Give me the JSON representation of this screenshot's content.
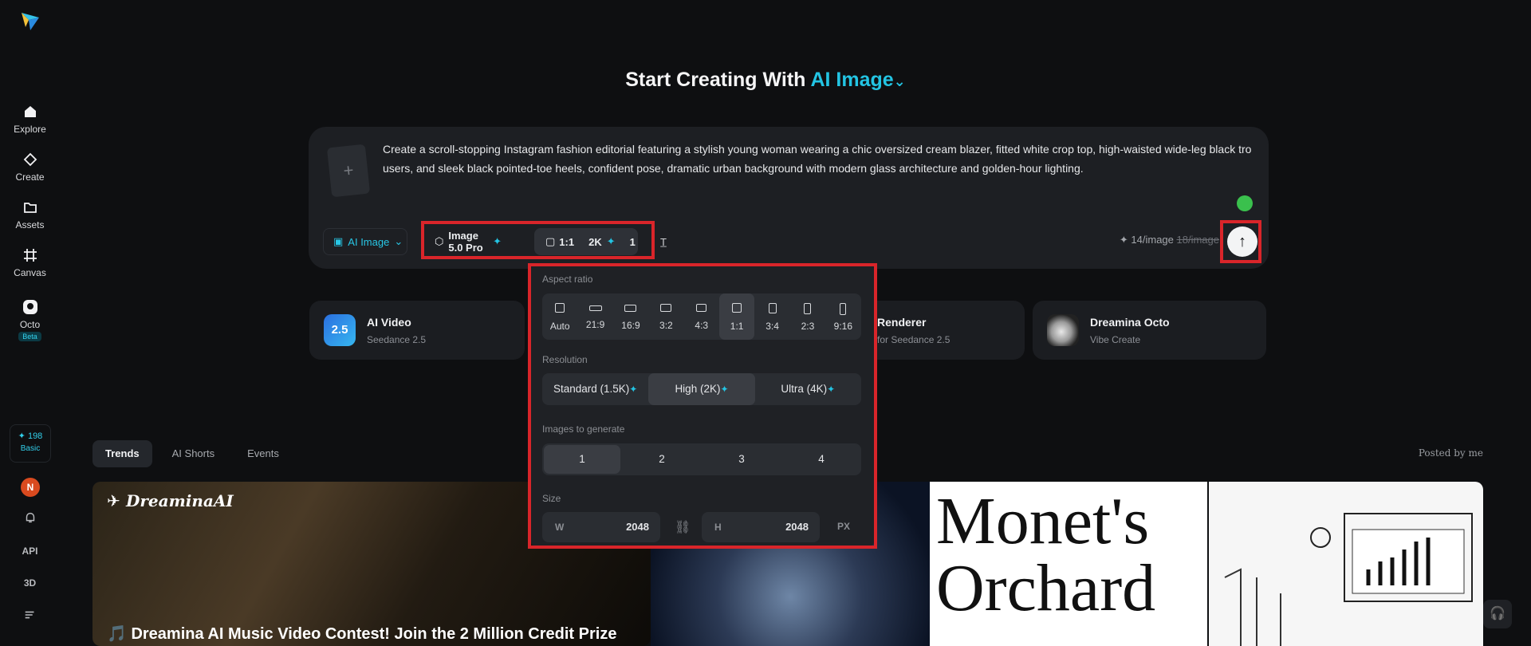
{
  "sidebar": {
    "items": [
      {
        "label": "Explore",
        "icon": "home-icon"
      },
      {
        "label": "Create",
        "icon": "diamond-icon"
      },
      {
        "label": "Assets",
        "icon": "folder-icon"
      },
      {
        "label": "Canvas",
        "icon": "canvas-icon"
      },
      {
        "label": "Octo",
        "icon": "octo-icon",
        "badge": "Beta"
      }
    ],
    "credits": {
      "amount": "✦ 198",
      "plan": "Basic"
    },
    "avatar_initial": "N",
    "api_label": "API",
    "threed_label": "3D"
  },
  "header": {
    "title_prefix": "Start Creating With",
    "title_accent": "AI Image"
  },
  "prompt": {
    "text": "Create a scroll-stopping Instagram fashion editorial featuring a stylish young woman wearing a chic oversized cream blazer, fitted white crop top, high-waisted wide-leg black trousers, and sleek black pointed-toe heels, confident pose, dramatic urban background with modern glass architecture and golden-hour lighting."
  },
  "toolbar": {
    "mode": "AI Image",
    "model": "Image 5.0 Pro",
    "ratio": "1:1",
    "resolution": "2K",
    "count": "1",
    "cost": "14/image",
    "cost_old": "18/image"
  },
  "features": [
    {
      "name": "AI Video",
      "sub": "Seedance 2.5",
      "icon_text": "2.5"
    },
    {
      "name": "Renderer",
      "sub": "for Seedance 2.5"
    },
    {
      "name": "Dreamina Octo",
      "sub": "Vibe Create"
    }
  ],
  "tabs": [
    "Trends",
    "AI Shorts",
    "Events"
  ],
  "posted_by": "Posted by me",
  "gallery": {
    "brand": "DreaminaAI",
    "headline": "🎵 Dreamina AI Music Video Contest! Join the 2 Million Credit Prize",
    "monet_line1": "Monet's",
    "monet_line2": "Orchard"
  },
  "popover": {
    "aspect_label": "Aspect ratio",
    "ratios": [
      "Auto",
      "21:9",
      "16:9",
      "3:2",
      "4:3",
      "1:1",
      "3:4",
      "2:3",
      "9:16"
    ],
    "selected_ratio": "1:1",
    "resolution_label": "Resolution",
    "resolutions": [
      "Standard (1.5K)",
      "High (2K)",
      "Ultra (4K)"
    ],
    "selected_resolution": "High (2K)",
    "images_label": "Images to generate",
    "counts": [
      "1",
      "2",
      "3",
      "4"
    ],
    "selected_count": "1",
    "size_label": "Size",
    "width_label": "W",
    "width": "2048",
    "height_label": "H",
    "height": "2048",
    "unit": "PX"
  },
  "colors": {
    "accent": "#23c4e3",
    "highlight_box": "#d9252a",
    "background": "#0e0f11"
  }
}
